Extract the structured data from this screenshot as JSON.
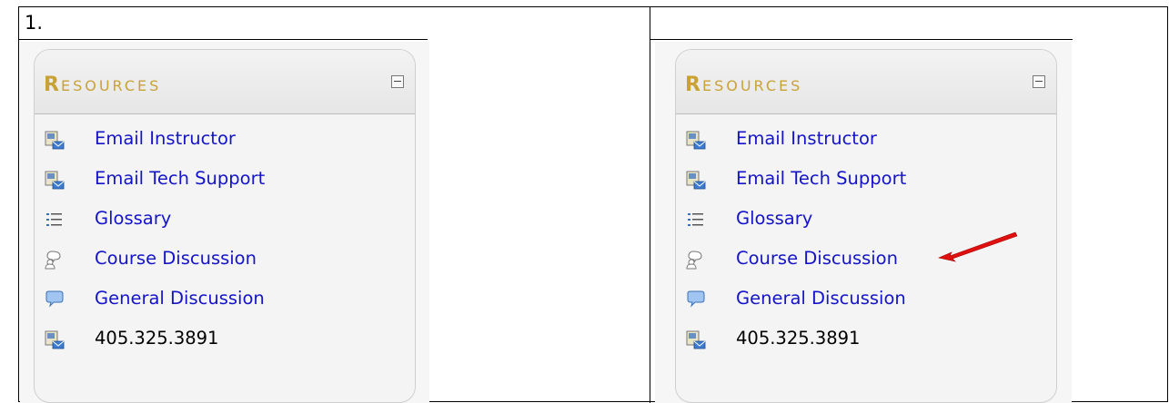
{
  "step": "1.",
  "panels": [
    {
      "id": "left",
      "block": {
        "title_first": "R",
        "title_rest": "ESOURCES",
        "items": [
          {
            "label": "Email Instructor",
            "icon": "email-icon",
            "link": true
          },
          {
            "label": "Email Tech Support",
            "icon": "email-icon",
            "link": true
          },
          {
            "label": "Glossary",
            "icon": "list-icon",
            "link": true
          },
          {
            "label": "Course Discussion",
            "icon": "forum-icon",
            "link": true
          },
          {
            "label": "General Discussion",
            "icon": "chat-bubble-icon",
            "link": true
          },
          {
            "label": "405.325.3891",
            "icon": "email-icon",
            "link": false
          }
        ]
      }
    },
    {
      "id": "right",
      "block": {
        "title_first": "R",
        "title_rest": "ESOURCES",
        "items": [
          {
            "label": "Email Instructor",
            "icon": "email-icon",
            "link": true
          },
          {
            "label": "Email Tech Support",
            "icon": "email-icon",
            "link": true
          },
          {
            "label": "Glossary",
            "icon": "list-icon",
            "link": true
          },
          {
            "label": "Course Discussion",
            "icon": "forum-icon",
            "link": true
          },
          {
            "label": "General Discussion",
            "icon": "chat-bubble-icon",
            "link": true
          },
          {
            "label": "405.325.3891",
            "icon": "email-icon",
            "link": false
          }
        ]
      }
    }
  ],
  "colors": {
    "link": "#1414c8",
    "title": "#c9a236",
    "arrow": "#e01010"
  }
}
